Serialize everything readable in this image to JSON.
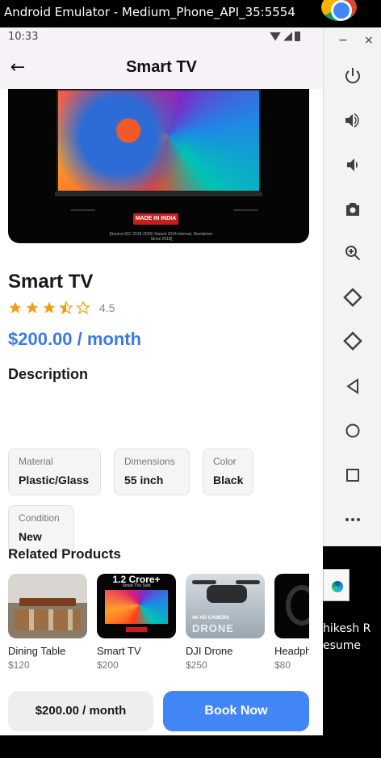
{
  "window": {
    "title": "Android Emulator - Medium_Phone_API_35:5554"
  },
  "status": {
    "time": "10:33"
  },
  "appbar": {
    "title": "Smart TV"
  },
  "hero": {
    "badge": "MADE IN INDIA",
    "disclaimer": "[Source:IDC 2018-2025/ Xiaomi 2024 Internal, Disclaimer: Since 2018]"
  },
  "product": {
    "name": "Smart TV",
    "rating": 3.5,
    "rating_text": "4.5",
    "price": "$200.00 / month",
    "description_title": "Description"
  },
  "specs": [
    {
      "label": "Material",
      "value": "Plastic/Glass"
    },
    {
      "label": "Dimensions",
      "value": "55 inch"
    },
    {
      "label": "Color",
      "value": "Black"
    },
    {
      "label": "Condition",
      "value": "New"
    }
  ],
  "related": {
    "title": "Related Products",
    "items": [
      {
        "name": "Dining Table",
        "price": "$120",
        "image": "dining-table"
      },
      {
        "name": "Smart TV",
        "price": "$200",
        "image": "smart-tv",
        "overlay_title": "1.2 Crore+",
        "overlay_sub": "Smart TVs Sold"
      },
      {
        "name": "DJI Drone",
        "price": "$250",
        "image": "drone",
        "overlay_title": "4K HD CAMERA",
        "overlay_sub": "DRONE"
      },
      {
        "name": "Headphones",
        "price": "$80",
        "image": "headphones"
      }
    ]
  },
  "bottom": {
    "price_button": "$200.00 / month",
    "book_button": "Book Now"
  },
  "emulator": {
    "minimize": "−",
    "close": "×",
    "tools": [
      "power-icon",
      "volume-up-icon",
      "volume-down-icon",
      "camera-icon",
      "zoom-icon",
      "rotate-left-icon",
      "rotate-right-icon",
      "back-icon",
      "home-icon",
      "overview-icon",
      "more-icon"
    ]
  },
  "desktop": {
    "label_line1": "hikesh R",
    "label_line2": "esume"
  },
  "colors": {
    "accent": "#4285f4",
    "price": "#3a7be8",
    "star": "#f39c12",
    "appbar": "#f6f2f8"
  }
}
